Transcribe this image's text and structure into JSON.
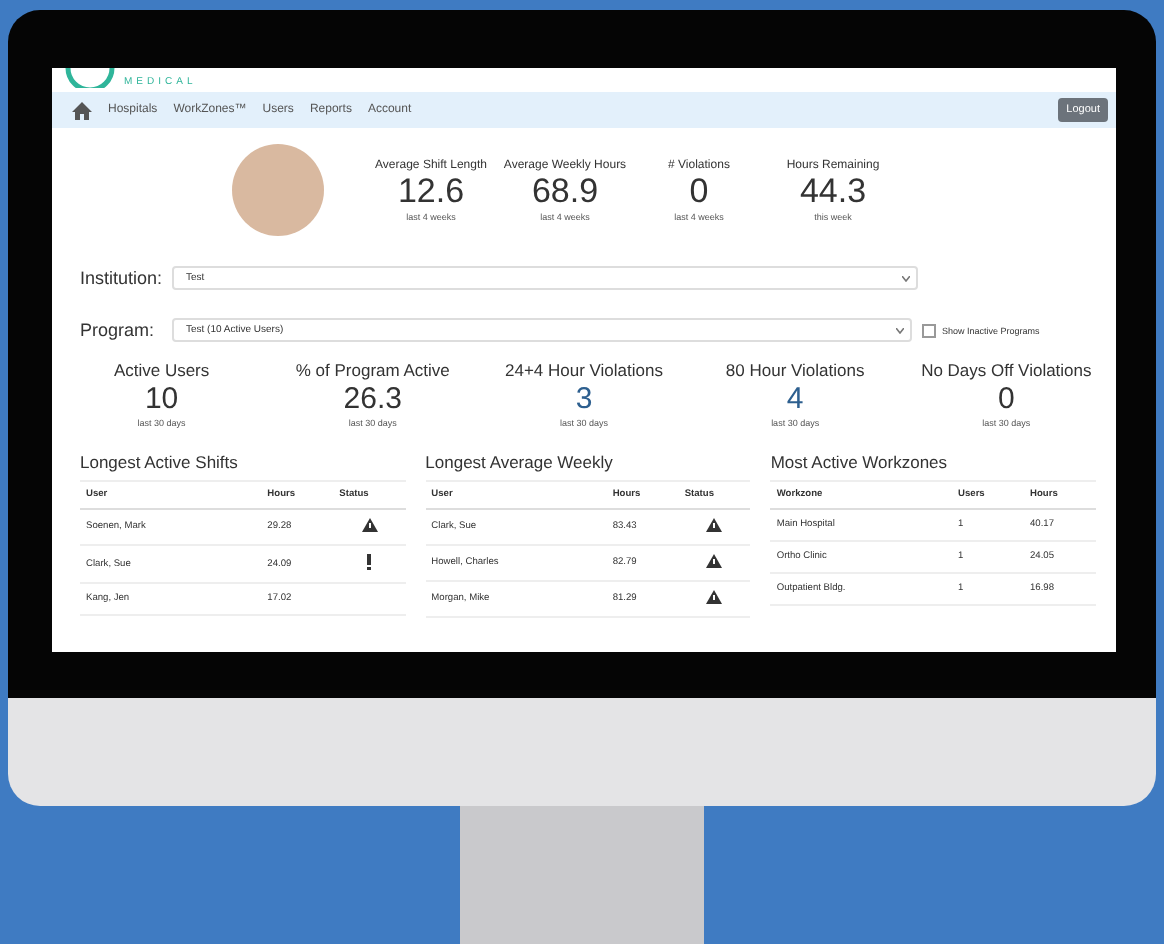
{
  "logo": {
    "subtitle": "MEDICAL"
  },
  "nav": {
    "items": [
      "Hospitals",
      "WorkZones™",
      "Users",
      "Reports",
      "Account"
    ],
    "logout": "Logout"
  },
  "summary": [
    {
      "label": "Average Shift Length",
      "value": "12.6",
      "period": "last 4 weeks"
    },
    {
      "label": "Average Weekly Hours",
      "value": "68.9",
      "period": "last 4 weeks"
    },
    {
      "label": "# Violations",
      "value": "0",
      "period": "last 4 weeks"
    },
    {
      "label": "Hours Remaining",
      "value": "44.3",
      "period": "this week"
    }
  ],
  "institution": {
    "label": "Institution:",
    "value": "Test"
  },
  "program": {
    "label": "Program:",
    "value": "Test (10 Active Users)",
    "show_inactive": {
      "label": "Show Inactive Programs",
      "checked": false
    }
  },
  "stats": [
    {
      "label": "Active Users",
      "value": "10",
      "period": "last 30 days",
      "link": false
    },
    {
      "label": "% of Program Active",
      "value": "26.3",
      "period": "last 30 days",
      "link": false
    },
    {
      "label": "24+4 Hour Violations",
      "value": "3",
      "period": "last 30 days",
      "link": true
    },
    {
      "label": "80 Hour Violations",
      "value": "4",
      "period": "last 30 days",
      "link": true
    },
    {
      "label": "No Days Off Violations",
      "value": "0",
      "period": "last 30 days",
      "link": false
    }
  ],
  "tables": [
    {
      "title": "Longest Active Shifts",
      "columns": [
        "User",
        "Hours",
        "Status"
      ],
      "rows": [
        {
          "cells": [
            "Soenen, Mark",
            "29.28"
          ],
          "kind": "warning"
        },
        {
          "cells": [
            "Clark, Sue",
            "24.09"
          ],
          "kind": "alert"
        },
        {
          "cells": [
            "Kang, Jen",
            "17.02"
          ]
        }
      ]
    },
    {
      "title": "Longest Average Weekly",
      "columns": [
        "User",
        "Hours",
        "Status"
      ],
      "rows": [
        {
          "cells": [
            "Clark, Sue",
            "83.43"
          ],
          "kind": "warning"
        },
        {
          "cells": [
            "Howell, Charles",
            "82.79"
          ],
          "kind": "warning"
        },
        {
          "cells": [
            "Morgan, Mike",
            "81.29"
          ],
          "kind": "warning"
        }
      ]
    },
    {
      "title": "Most Active Workzones",
      "columns": [
        "Workzone",
        "Users",
        "Hours"
      ],
      "rows": [
        {
          "cells": [
            "Main Hospital",
            "1",
            "40.17"
          ]
        },
        {
          "cells": [
            "Ortho Clinic",
            "1",
            "24.05"
          ]
        },
        {
          "cells": [
            "Outpatient Bldg.",
            "1",
            "16.98"
          ]
        }
      ]
    }
  ]
}
